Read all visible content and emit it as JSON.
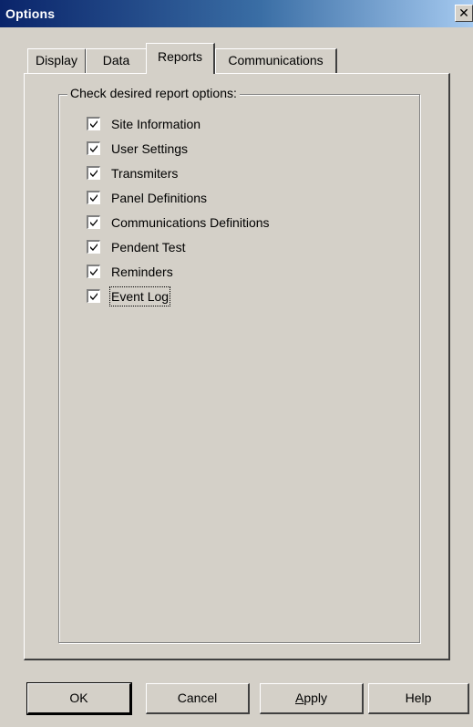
{
  "window": {
    "title": "Options",
    "close_glyph": "✕"
  },
  "tabs": [
    {
      "label": "Display",
      "selected": false
    },
    {
      "label": "Data",
      "selected": false
    },
    {
      "label": "Reports",
      "selected": true
    },
    {
      "label": "Communications",
      "selected": false
    }
  ],
  "group": {
    "legend": "Check desired report options:"
  },
  "options": [
    {
      "label": "Site Information",
      "checked": true
    },
    {
      "label": "User Settings",
      "checked": true
    },
    {
      "label": "Transmiters",
      "checked": true
    },
    {
      "label": "Panel Definitions",
      "checked": true
    },
    {
      "label": "Communications Definitions",
      "checked": true
    },
    {
      "label": "Pendent Test",
      "checked": true
    },
    {
      "label": "Reminders",
      "checked": true
    },
    {
      "label": "Event Log",
      "checked": true
    }
  ],
  "buttons": {
    "ok": "OK",
    "cancel": "Cancel",
    "apply_mnemonic": "A",
    "apply_rest": "pply",
    "help": "Help"
  },
  "colors": {
    "title_start": "#0a246a",
    "title_end": "#a6caf0",
    "face": "#d4d0c8"
  },
  "icons": {
    "close": "close-icon",
    "check": "checkmark-icon"
  }
}
